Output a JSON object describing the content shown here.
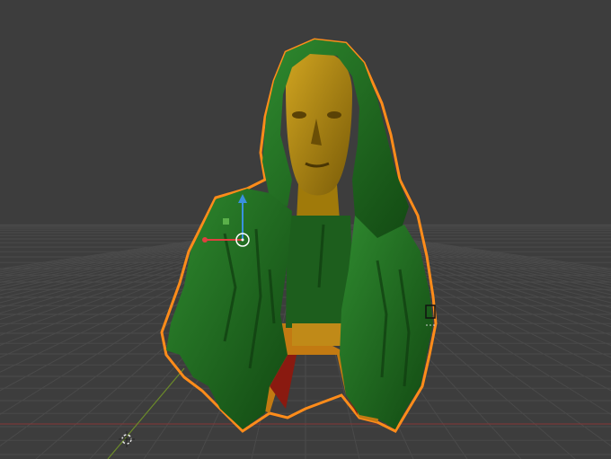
{
  "viewport": {
    "background": "#3d3d3d",
    "grid_color": "#4a4a4a",
    "axis_x_color": "#8a3b3b",
    "axis_y_color": "#6a8a2a"
  },
  "scene_object": {
    "description_icon": "hooded-figure-mesh",
    "cloak_color": "#1e6a1e",
    "skin_color": "#b08a10",
    "selection_outline_color": "#ff8c1a"
  },
  "gizmo": {
    "x_axis_color": "#e04040",
    "z_axis_color": "#3a90e0",
    "plane_handle_color": "#5ab04a",
    "pivot_color": "#ffffff"
  },
  "cursor_3d": {
    "icon": "3d-cursor-icon"
  }
}
